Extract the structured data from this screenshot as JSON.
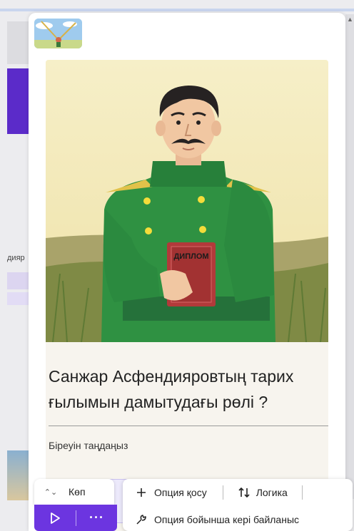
{
  "background": {
    "partial_label": "дияр"
  },
  "question": {
    "text": "Санжар Асфендияровтың тарих ғылымын дамытудағы рөлі ?",
    "instruction": "Біреуін таңдаңыз",
    "image_book_text": "ДИПЛОМ"
  },
  "toolbar": {
    "type_selector_label": "Көп",
    "add_option_label": "Опция қосу",
    "logic_label": "Логика",
    "feedback_label": "Опция бойынша кері байланыс"
  },
  "colors": {
    "accent": "#6c35e0",
    "option_bg": "#ece9fb",
    "card_bg": "#f7f4ee"
  }
}
